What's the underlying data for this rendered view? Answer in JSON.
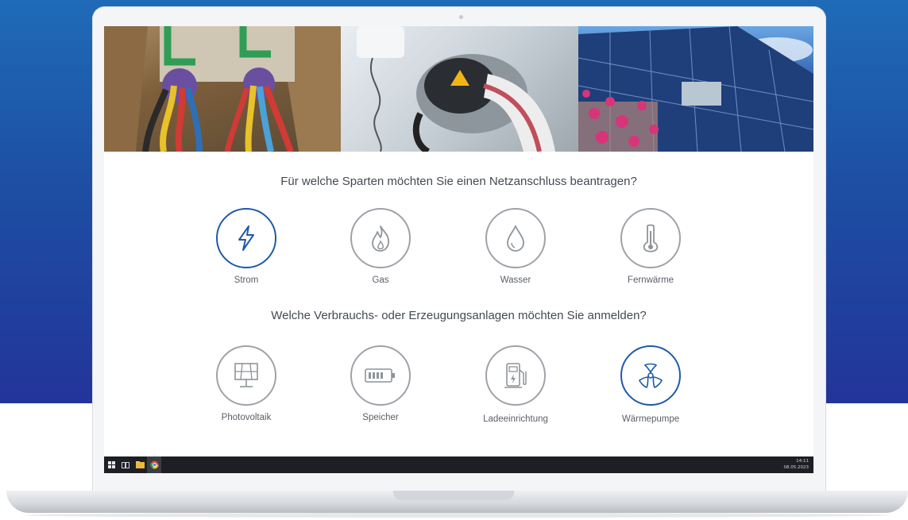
{
  "colors": {
    "accent": "#1e5ba8",
    "inactive": "#9ea3a9",
    "background_band": "#23349a"
  },
  "questions": {
    "sparten": "Für welche Sparten möchten Sie einen Netzanschluss beantragen?",
    "anlagen": "Welche Verbrauchs- oder Erzeugungsanlagen möchten Sie anmelden?"
  },
  "sparten": [
    {
      "label": "Strom",
      "icon": "lightning-icon",
      "selected": true
    },
    {
      "label": "Gas",
      "icon": "flame-icon",
      "selected": false
    },
    {
      "label": "Wasser",
      "icon": "water-drop-icon",
      "selected": false
    },
    {
      "label": "Fernwärme",
      "icon": "thermometer-icon",
      "selected": false
    }
  ],
  "anlagen": [
    {
      "label": "Photovoltaik",
      "icon": "solar-panel-icon",
      "selected": false
    },
    {
      "label": "Speicher",
      "icon": "battery-icon",
      "selected": false
    },
    {
      "label": "Ladeeinrichtung",
      "icon": "charging-station-icon",
      "selected": false
    },
    {
      "label": "Wärmepumpe",
      "icon": "heat-pump-fan-icon",
      "selected": true
    }
  ],
  "hero_images": [
    "cable-trench-photo",
    "ev-charging-photo",
    "solar-roof-photo"
  ],
  "taskbar": {
    "icons": [
      "windows-start-icon",
      "task-view-icon",
      "file-explorer-icon",
      "chrome-icon"
    ],
    "time": "14:11",
    "date": "08.05.2023"
  }
}
